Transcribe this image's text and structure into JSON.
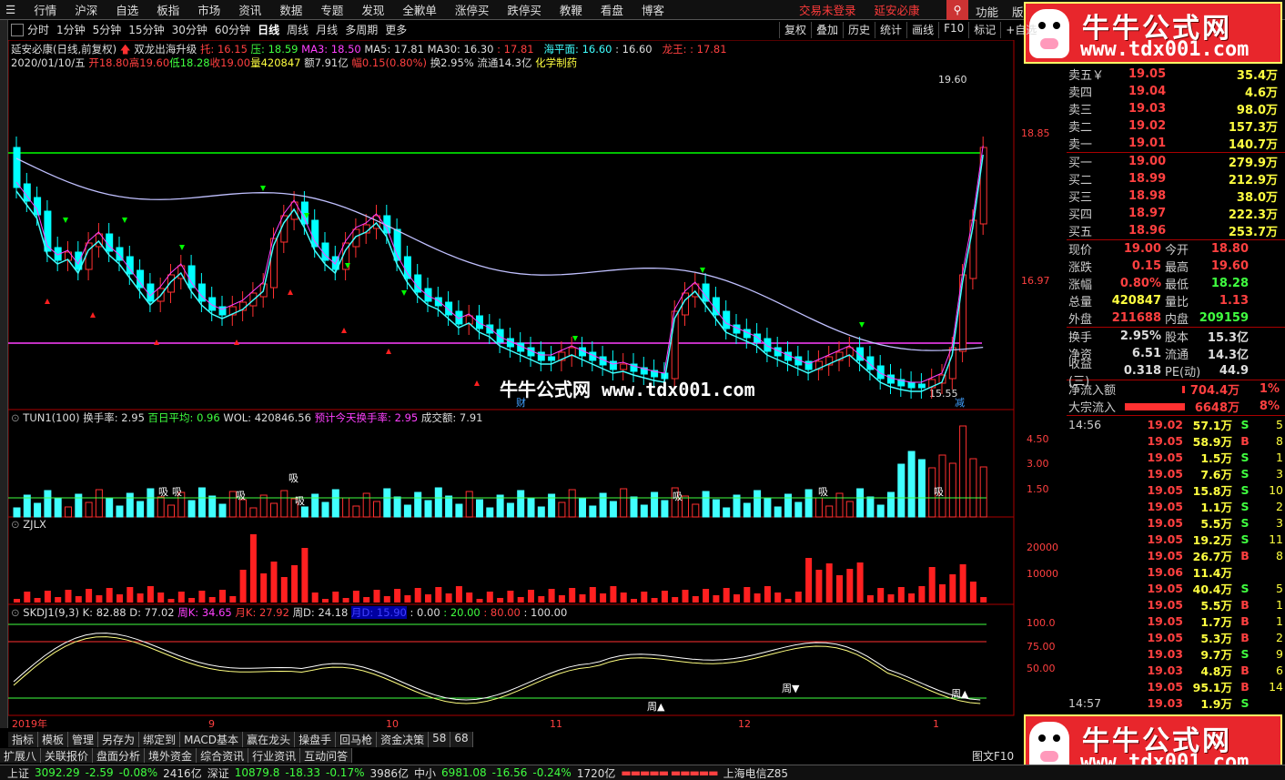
{
  "menu": {
    "items": [
      "行情",
      "沪深",
      "自选",
      "板指",
      "市场",
      "资讯",
      "数据",
      "专题",
      "发现",
      "全歉单",
      "涨停买",
      "跌停买",
      "教鞭",
      "看盘",
      "博客"
    ],
    "trade_status": "交易未登录",
    "stock_name": "延安必康",
    "func": "功能",
    "edition": "版"
  },
  "logo": {
    "cn": "牛牛公式网",
    "url": "www.tdx001.com"
  },
  "periods": [
    "分时",
    "1分钟",
    "5分钟",
    "15分钟",
    "30分钟",
    "60分钟",
    "日线",
    "周线",
    "月线",
    "多周期",
    "更多"
  ],
  "active_period": "日线",
  "right_toolbar": [
    "复权",
    "叠加",
    "历史",
    "统计",
    "画线",
    "F10",
    "标记",
    "+自选"
  ],
  "header": {
    "title": "延安必康(日线,前复权)",
    "indicator": "双龙出海升级",
    "tuo": "托: 16.15",
    "ya": "压: 18.59",
    "ma3": "MA3: 18.50",
    "ma5": "MA5: 17.81",
    "ma30": "MA30: 16.30",
    "ma30b": ": 17.81",
    "haiping": "海平面: 16.60",
    "haiping2": ": 16.60",
    "longwang": "龙王: ",
    "longwang2": ": 17.81",
    "date": "2020/01/10/五",
    "open": "开18.80",
    "high": "高19.60",
    "low": "低18.28",
    "close": "收19.00",
    "vol": "量420847",
    "amt": "额7.91亿",
    "chg": "幅0.15(0.80%)",
    "turn": "换2.95%",
    "float": "流通14.3亿",
    "industry": "化学制药"
  },
  "main_chart": {
    "y_labels": [
      "18.85",
      "16.97"
    ],
    "high_label": "19.60",
    "low_label": "15.55",
    "watermark": "牛牛公式网 www.tdx001.com",
    "cai": "财",
    "jian": "减"
  },
  "chart_data": [
    {
      "type": "bar",
      "title": "TUN1(100)",
      "ylim": [
        0,
        5
      ],
      "y_labels": [
        "4.50",
        "3.00",
        "1.50"
      ],
      "legend": [
        "换手率: 2.95",
        "百日平均: 0.96",
        "WOL: 420846.56",
        "预计今天换手率: 2.95",
        "成交额: 7.91"
      ],
      "xi_labels": [
        "吸",
        "吸",
        "吸",
        "吸",
        "吸",
        "吸",
        "吸",
        "吸"
      ]
    },
    {
      "type": "bar",
      "title": "ZJLX",
      "y_labels": [
        "20000",
        "10000"
      ]
    },
    {
      "type": "line",
      "title": "SKDJ1(9,3)",
      "ylim": [
        0,
        100
      ],
      "legend": [
        "K: 82.88",
        "D: 77.02",
        "周K: 34.65",
        "月K: 27.92",
        "周D: 24.18",
        "月D: 15.90",
        ": 0.00",
        ": 20.00",
        ": 80.00",
        ": 100.00"
      ],
      "y_labels": [
        "100.0",
        "75.00",
        "50.00"
      ],
      "markers": [
        "周▲",
        "周▼",
        "周▲"
      ]
    }
  ],
  "xaxis": [
    "2019年",
    "9",
    "10",
    "11",
    "12",
    "1"
  ],
  "quote": {
    "sell": [
      {
        "label": "卖五￥",
        "price": "19.05",
        "vol": "35.4万"
      },
      {
        "label": "卖四",
        "price": "19.04",
        "vol": "4.6万"
      },
      {
        "label": "卖三",
        "price": "19.03",
        "vol": "98.0万"
      },
      {
        "label": "卖二",
        "price": "19.02",
        "vol": "157.3万"
      },
      {
        "label": "卖一",
        "price": "19.01",
        "vol": "140.7万"
      }
    ],
    "buy": [
      {
        "label": "买一",
        "price": "19.00",
        "vol": "279.9万"
      },
      {
        "label": "买二",
        "price": "18.99",
        "vol": "212.9万"
      },
      {
        "label": "买三",
        "price": "18.98",
        "vol": "38.0万"
      },
      {
        "label": "买四",
        "price": "18.97",
        "vol": "222.3万"
      },
      {
        "label": "买五",
        "price": "18.96",
        "vol": "253.7万"
      }
    ],
    "stats": [
      {
        "a": "现价",
        "b": "19.00",
        "bc": "#ff4040",
        "c": "今开",
        "d": "18.80",
        "dc": "#ff4040"
      },
      {
        "a": "涨跌",
        "b": "0.15",
        "bc": "#ff4040",
        "c": "最高",
        "d": "19.60",
        "dc": "#ff4040"
      },
      {
        "a": "涨幅",
        "b": "0.80%",
        "bc": "#ff4040",
        "c": "最低",
        "d": "18.28",
        "dc": "#40ff40"
      },
      {
        "a": "总量",
        "b": "420847",
        "bc": "#ffff40",
        "c": "量比",
        "d": "1.13",
        "dc": "#ff4040"
      },
      {
        "a": "外盘",
        "b": "211688",
        "bc": "#ff4040",
        "c": "内盘",
        "d": "209159",
        "dc": "#40ff40"
      }
    ],
    "stats2": [
      {
        "a": "换手",
        "b": "2.95%",
        "bc": "#ddd",
        "c": "股本",
        "d": "15.3亿",
        "dc": "#ddd"
      },
      {
        "a": "净资",
        "b": "6.51",
        "bc": "#ddd",
        "c": "流通",
        "d": "14.3亿",
        "dc": "#ddd"
      },
      {
        "a": "收益(三)",
        "b": "0.318",
        "bc": "#ddd",
        "c": "PE(动)",
        "d": "44.9",
        "dc": "#ddd"
      }
    ],
    "flow": [
      {
        "label": "净流入额",
        "val": "704.4万",
        "pct": "1%",
        "fill": 0.05
      },
      {
        "label": "大宗流入",
        "val": "6648万",
        "pct": "8%",
        "fill": 0.95
      }
    ],
    "ticks": [
      {
        "t": "14:56",
        "p": "19.02",
        "v": "57.1万",
        "s": "S",
        "n": "5"
      },
      {
        "t": "",
        "p": "19.05",
        "v": "58.9万",
        "s": "B",
        "n": "8"
      },
      {
        "t": "",
        "p": "19.05",
        "v": "1.5万",
        "s": "S",
        "n": "1"
      },
      {
        "t": "",
        "p": "19.05",
        "v": "7.6万",
        "s": "S",
        "n": "3"
      },
      {
        "t": "",
        "p": "19.05",
        "v": "15.8万",
        "s": "S",
        "n": "10"
      },
      {
        "t": "",
        "p": "19.05",
        "v": "1.1万",
        "s": "S",
        "n": "2"
      },
      {
        "t": "",
        "p": "19.05",
        "v": "5.5万",
        "s": "S",
        "n": "3"
      },
      {
        "t": "",
        "p": "19.05",
        "v": "19.2万",
        "s": "S",
        "n": "11"
      },
      {
        "t": "",
        "p": "19.05",
        "v": "26.7万",
        "s": "B",
        "n": "8"
      },
      {
        "t": "",
        "p": "19.06",
        "v": "11.4万",
        "s": "",
        "n": ""
      },
      {
        "t": "",
        "p": "19.05",
        "v": "40.4万",
        "s": "S",
        "n": "5"
      },
      {
        "t": "",
        "p": "19.05",
        "v": "5.5万",
        "s": "B",
        "n": "1"
      },
      {
        "t": "",
        "p": "19.05",
        "v": "1.7万",
        "s": "B",
        "n": "1"
      },
      {
        "t": "",
        "p": "19.05",
        "v": "5.3万",
        "s": "B",
        "n": "2"
      },
      {
        "t": "",
        "p": "19.03",
        "v": "9.7万",
        "s": "S",
        "n": "9"
      },
      {
        "t": "",
        "p": "19.03",
        "v": "4.8万",
        "s": "B",
        "n": "6"
      },
      {
        "t": "",
        "p": "19.05",
        "v": "95.1万",
        "s": "B",
        "n": "14"
      },
      {
        "t": "14:57",
        "p": "19.03",
        "v": "1.9万",
        "s": "S",
        "n": ""
      }
    ]
  },
  "bottom_tabs": [
    "指标",
    "模板",
    "管理",
    "另存为",
    "绑定到",
    "MACD基本",
    "赢在龙头",
    "操盘手",
    "回马枪",
    "资金决策",
    "58",
    "68"
  ],
  "bottom_tabs2": [
    "扩展八",
    "关联报价",
    "盘面分析",
    "境外资金",
    "综合资讯",
    "行业资讯",
    "互动问答"
  ],
  "right_corner": "图文F10",
  "status": {
    "sh_label": "上证",
    "sh_val": "3092.29",
    "sh_chg": "-2.59",
    "sh_pct": "-0.08%",
    "sh_amt": "2416亿",
    "sz_label": "深证",
    "sz_val": "10879.8",
    "sz_chg": "-18.33",
    "sz_pct": "-0.17%",
    "sz_amt": "3986亿",
    "zx_label": "中小",
    "zx_val": "6981.08",
    "zx_chg": "-16.56",
    "zx_pct": "-0.24%",
    "zx_amt": "1720亿",
    "server": "上海电信Z85"
  },
  "colors": {
    "up": "#ff3030",
    "down": "#00ffff",
    "ma": "#ffffff",
    "green": "#00ff00",
    "magenta": "#ff40ff"
  }
}
